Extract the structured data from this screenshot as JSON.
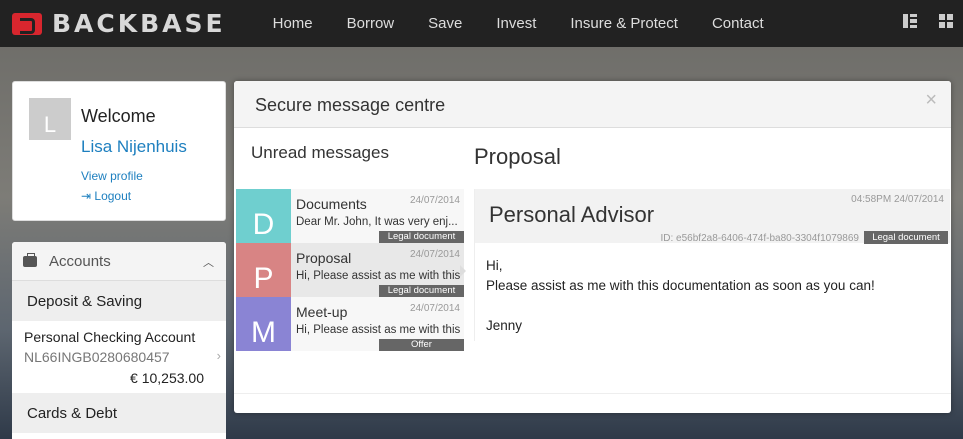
{
  "navbar": {
    "brand": "BACKBASE",
    "items": [
      "Home",
      "Borrow",
      "Save",
      "Invest",
      "Insure & Protect",
      "Contact"
    ]
  },
  "profile": {
    "avatar_letter": "L",
    "welcome": "Welcome",
    "name": "Lisa Nijenhuis",
    "view_profile": "View profile",
    "logout": "Logout"
  },
  "accounts": {
    "header": "Accounts",
    "groups": [
      "Deposit & Saving",
      "Cards & Debt"
    ],
    "account": {
      "name": "Personal Checking Account",
      "iban": "NL66INGB0280680457",
      "balance": "€ 10,253.00"
    }
  },
  "modal": {
    "title": "Secure message centre",
    "close": "×",
    "unread_title": "Unread messages",
    "messages": [
      {
        "letter": "D",
        "color": "#6fcfcf",
        "subject": "Documents",
        "date": "24/07/2014",
        "preview": "Dear Mr. John, It was very enj...",
        "tag": "Legal document"
      },
      {
        "letter": "P",
        "color": "#d88484",
        "subject": "Proposal",
        "date": "24/07/2014",
        "preview": "Hi, Please assist as me with this ...",
        "tag": "Legal document"
      },
      {
        "letter": "M",
        "color": "#8a84d4",
        "subject": "Meet-up",
        "date": "24/07/2014",
        "preview": "Hi, Please assist as me with this ...",
        "tag": "Offer"
      }
    ],
    "detail": {
      "subject": "Proposal",
      "from": "Personal Advisor",
      "time": "04:58PM 24/07/2014",
      "id": "ID: e56bf2a8-6406-474f-ba80-3304f1079869",
      "tag": "Legal document",
      "greeting": "Hi,",
      "body": "Please assist as me with this documentation as soon as you can!",
      "signature": "Jenny"
    }
  }
}
